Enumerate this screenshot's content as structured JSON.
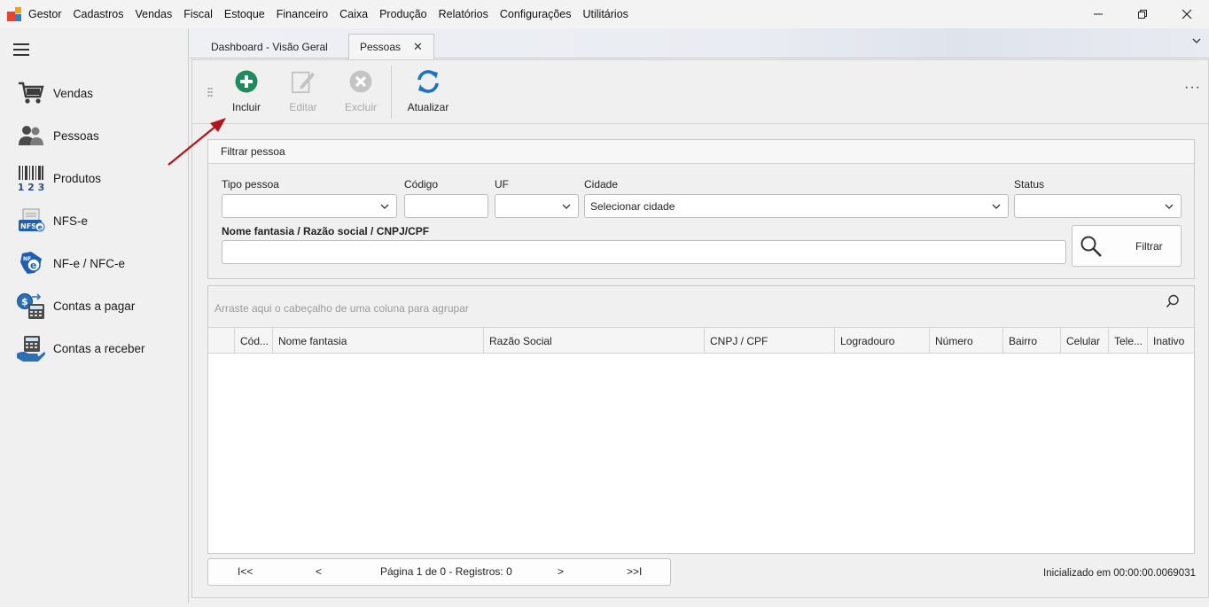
{
  "menubar": {
    "items": [
      "Gestor",
      "Cadastros",
      "Vendas",
      "Fiscal",
      "Estoque",
      "Financeiro",
      "Caixa",
      "Produção",
      "Relatórios",
      "Configurações",
      "Utilitários"
    ]
  },
  "sidebar": {
    "items": [
      {
        "label": "Vendas",
        "icon": "cart-icon"
      },
      {
        "label": "Pessoas",
        "icon": "people-icon"
      },
      {
        "label": "Produtos",
        "icon": "barcode-icon"
      },
      {
        "label": "NFS-e",
        "icon": "nfse-icon"
      },
      {
        "label": "NF-e / NFC-e",
        "icon": "nfe-icon"
      },
      {
        "label": "Contas a pagar",
        "icon": "accounts-payable-icon"
      },
      {
        "label": "Contas a receber",
        "icon": "accounts-receivable-icon"
      }
    ]
  },
  "tabs": [
    {
      "label": "Dashboard - Visão Geral",
      "active": false
    },
    {
      "label": "Pessoas",
      "active": true
    }
  ],
  "toolbar": {
    "incluir": "Incluir",
    "editar": "Editar",
    "excluir": "Excluir",
    "atualizar": "Atualizar"
  },
  "filter": {
    "title": "Filtrar pessoa",
    "tipo_pessoa_label": "Tipo pessoa",
    "codigo_label": "Código",
    "uf_label": "UF",
    "cidade_label": "Cidade",
    "cidade_value": "Selecionar cidade",
    "status_label": "Status",
    "nome_label": "Nome fantasia / Razão social / CNPJ/CPF",
    "filtrar_button": "Filtrar"
  },
  "grid": {
    "group_hint": "Arraste aqui o cabeçalho de uma coluna para agrupar",
    "columns": [
      "Cód...",
      "Nome fantasia",
      "Razão Social",
      "CNPJ / CPF",
      "Logradouro",
      "Número",
      "Bairro",
      "Celular",
      "Tele...",
      "Inativo"
    ]
  },
  "pager": {
    "first": "I<<",
    "prev": "<",
    "info": "Página 1 de 0 - Registros: 0",
    "next": ">",
    "last": ">>I"
  },
  "status": "Inicializado em 00:00:00.0069031",
  "colors": {
    "accent_green": "#1e8a5e",
    "accent_blue": "#1a73c8",
    "annotation_red": "#b0161b"
  }
}
